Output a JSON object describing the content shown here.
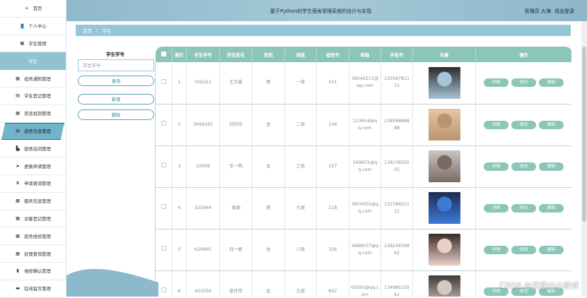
{
  "header": {
    "title": "基于Python的学生宿舍管理系统的设计与实现",
    "user": "管理员 大海",
    "logout": "退出登录"
  },
  "sidebar": {
    "items": [
      {
        "label": "首页",
        "icon": "home-icon",
        "glyph": "⌂"
      },
      {
        "label": "个人中心",
        "icon": "user-icon",
        "glyph": "👤"
      },
      {
        "label": "学生管理",
        "icon": "grid-icon",
        "glyph": "▦"
      },
      {
        "label": "学生",
        "icon": "",
        "glyph": ""
      },
      {
        "label": "宿舍通知管理",
        "icon": "grid-icon",
        "glyph": "▦"
      },
      {
        "label": "学生登记管理",
        "icon": "document-icon",
        "glyph": "▤"
      },
      {
        "label": "奖惩机制管理",
        "icon": "grid-icon",
        "glyph": "▦"
      },
      {
        "label": "宿舍信息管理",
        "icon": "document-icon",
        "glyph": "▤"
      },
      {
        "label": "宿舍房间管理",
        "icon": "building-icon",
        "glyph": "▙"
      },
      {
        "label": "更换申请管理",
        "icon": "send-icon",
        "glyph": "➤"
      },
      {
        "label": "申请查询管理",
        "icon": "trophy-icon",
        "glyph": "♛"
      },
      {
        "label": "服务信息管理",
        "icon": "grid-icon",
        "glyph": "▦"
      },
      {
        "label": "访客登记管理",
        "icon": "grid-icon",
        "glyph": "▦"
      },
      {
        "label": "宿舍维修管理",
        "icon": "grid-icon",
        "glyph": "▦"
      },
      {
        "label": "处理查询管理",
        "icon": "grid-icon",
        "glyph": "▦"
      },
      {
        "label": "维修确认管理",
        "icon": "bar-chart-icon",
        "glyph": "▮"
      },
      {
        "label": "在线留言管理",
        "icon": "monitor-icon",
        "glyph": "▬"
      }
    ]
  },
  "breadcrumb": {
    "home": "首页",
    "sep": "/",
    "current": "学生"
  },
  "search": {
    "label": "学生学号",
    "placeholder": "学生学号",
    "query_button": "查询",
    "add_button": "新增",
    "delete_button": "删除"
  },
  "table": {
    "headers": [
      "",
      "索引",
      "学生学号",
      "学生姓名",
      "性别",
      "班级",
      "宿舍号",
      "邮箱",
      "手机号",
      "头像",
      "操作"
    ],
    "actions": {
      "detail": "详情",
      "edit": "修改",
      "delete": "删除"
    },
    "rows": [
      {
        "index": "1",
        "student_id": "356221",
        "name": "王大拿",
        "gender": "男",
        "class": "一班",
        "room": "101",
        "email": "36542211@qq.com",
        "phone": "13056781111",
        "avatar_colors": [
          "#2a2a2a",
          "#a7c4d6"
        ]
      },
      {
        "index": "2",
        "student_id": "3694265",
        "name": "刘可可",
        "gender": "女",
        "class": "二班",
        "room": "106",
        "email": "123654@qq.com",
        "phone": "13856888888",
        "avatar_colors": [
          "#e7c6a6",
          "#b9946f"
        ]
      },
      {
        "index": "3",
        "student_id": "32569",
        "name": "王一鸣",
        "gender": "女",
        "class": "三班",
        "room": "107",
        "email": "569872@qq.com",
        "phone": "13823855555",
        "avatar_colors": [
          "#c9c6c2",
          "#7b6a64"
        ]
      },
      {
        "index": "4",
        "student_id": "325964",
        "name": "张瀚",
        "gender": "男",
        "class": "七班",
        "room": "118",
        "email": "3654055@qq.com",
        "phone": "13158652111",
        "avatar_colors": [
          "#1d2b4f",
          "#3d7ad8"
        ]
      },
      {
        "index": "5",
        "student_id": "624895",
        "name": "刘一帆",
        "gender": "女",
        "class": "八班",
        "room": "326",
        "email": "5689037@qq.com",
        "phone": "13823459862",
        "avatar_colors": [
          "#3a2a28",
          "#e9cfc6"
        ]
      },
      {
        "index": "6",
        "student_id": "453256",
        "name": "张环宫",
        "gender": "女",
        "class": "九班",
        "room": "602",
        "email": "65891@qq.com",
        "phone": "13498523542",
        "avatar_colors": [
          "#3b3b3b",
          "#d8c8c0"
        ]
      }
    ]
  },
  "watermark": "CSDN @无敌の小尝试"
}
